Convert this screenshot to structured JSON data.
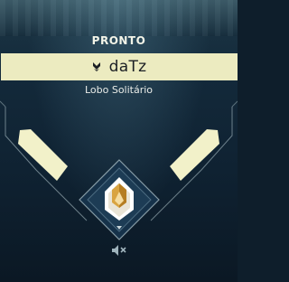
{
  "player": {
    "status": "PRONTO",
    "name": "daTz",
    "title": "Lobo Solitário",
    "agent_icon": "agent-icon",
    "rank_icon": "rank-emblem-icon",
    "voice_icon": "speaker-muted-icon"
  },
  "colors": {
    "name_bar": "#ecebc0",
    "accent_cream": "#f2f1c9",
    "frame_line": "#b9cdd3",
    "rank_gold": "#d9a441"
  }
}
